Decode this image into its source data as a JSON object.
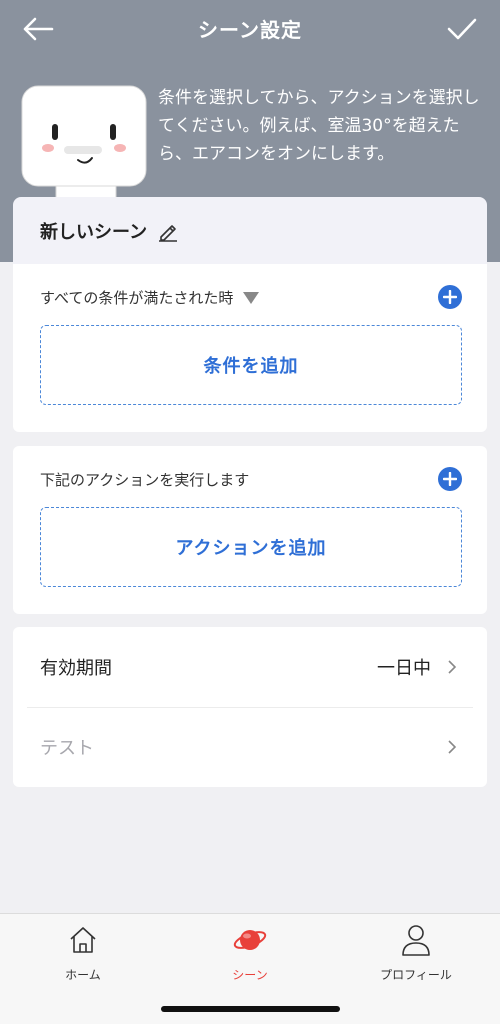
{
  "header": {
    "title": "シーン設定",
    "description": "条件を選択してから、アクションを選択してください。例えば、室温30°を超えたら、エアコンをオンにします。",
    "back_icon": "arrow-left-icon",
    "confirm_icon": "checkmark-icon"
  },
  "scene": {
    "name": "新しいシーン",
    "edit_icon": "pencil-icon"
  },
  "conditions": {
    "label": "すべての条件が満たされた時",
    "add_label": "条件を追加"
  },
  "actions": {
    "label": "下記のアクションを実行します",
    "add_label": "アクションを追加"
  },
  "settings": {
    "period_label": "有効期間",
    "period_value": "一日中",
    "test_label": "テスト"
  },
  "tabs": [
    {
      "label": "ホーム",
      "icon": "home-icon",
      "active": false
    },
    {
      "label": "シーン",
      "icon": "scene-icon",
      "active": true
    },
    {
      "label": "プロフィール",
      "icon": "person-icon",
      "active": false
    }
  ],
  "colors": {
    "header_bg": "#8a929e",
    "accent_blue": "#2f6fd6",
    "active_tab_red": "#e8403a"
  }
}
